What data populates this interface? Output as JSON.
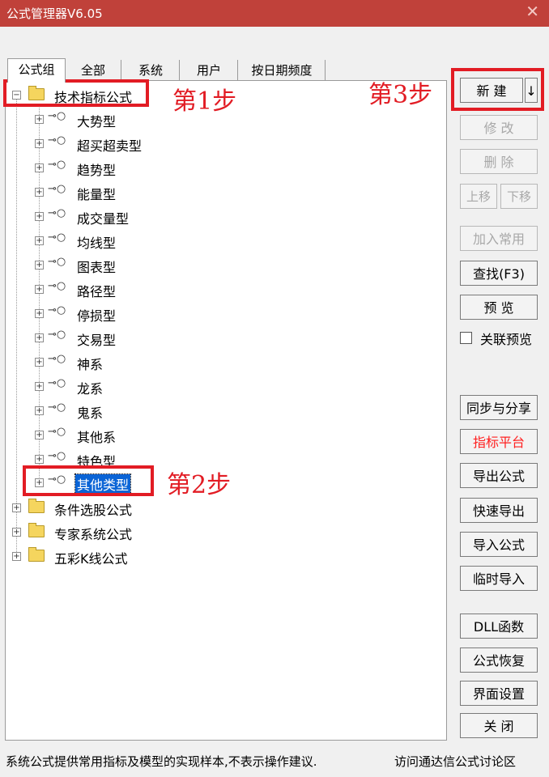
{
  "window": {
    "title": "公式管理器V6.05",
    "close_glyph": "✕"
  },
  "tabs": [
    "公式组",
    "全部",
    "系统",
    "用户",
    "按日期频度"
  ],
  "tree": {
    "root": {
      "label": "技术指标公式",
      "toggle": "−"
    },
    "children": [
      "大势型",
      "超买超卖型",
      "趋势型",
      "能量型",
      "成交量型",
      "均线型",
      "图表型",
      "路径型",
      "停损型",
      "交易型",
      "神系",
      "龙系",
      "鬼系",
      "其他系",
      "特色型",
      "其他类型"
    ],
    "selected": "其他类型",
    "folders": [
      "条件选股公式",
      "专家系统公式",
      "五彩K线公式"
    ],
    "expand_glyph": "+",
    "key_glyph": "⊸○"
  },
  "annotations": {
    "step1": "第1步",
    "step2": "第2步",
    "step3": "第3步",
    "color": "#e21c24"
  },
  "buttons": {
    "new": "新 建",
    "new_arrow": "↓",
    "modify": "修 改",
    "delete": "删 除",
    "up": "上移",
    "down": "下移",
    "add_common": "加入常用",
    "find": "查找(F3)",
    "preview": "预 览",
    "linked_preview": "关联预览",
    "sync_share": "同步与分享",
    "indicator_platform": "指标平台",
    "export_formula": "导出公式",
    "quick_export": "快速导出",
    "import_formula": "导入公式",
    "temp_import": "临时导入",
    "dll_function": "DLL函数",
    "restore_formula": "公式恢复",
    "ui_settings": "界面设置",
    "close": "关 闭"
  },
  "status": {
    "left": "系统公式提供常用指标及模型的实现样本,不表示操作建议.",
    "right": "访问通达信公式讨论区"
  },
  "colors": {
    "titlebar": "#c0413a",
    "selection": "#0a64d6",
    "platform_red": "#ff2020"
  }
}
